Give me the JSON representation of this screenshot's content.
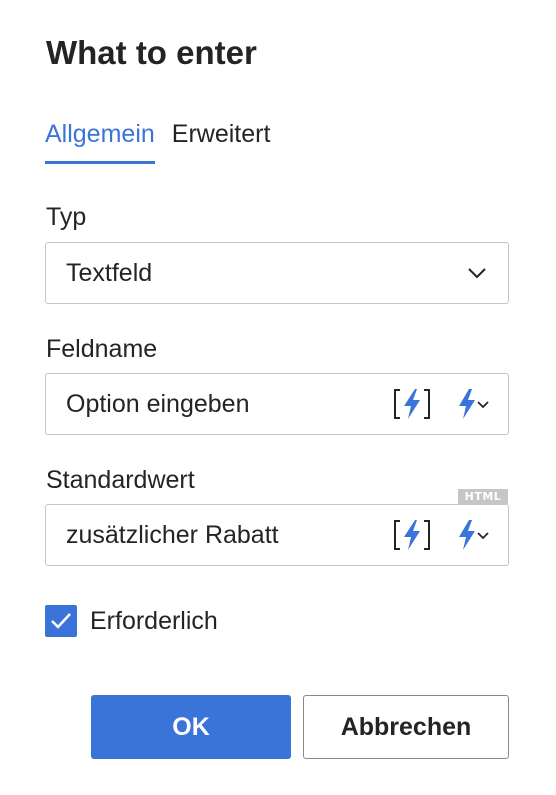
{
  "dialog": {
    "title": "What to enter"
  },
  "tabs": [
    {
      "label": "Allgemein",
      "active": true
    },
    {
      "label": "Erweitert",
      "active": false
    }
  ],
  "type_field": {
    "label": "Typ",
    "value": "Textfeld",
    "icon": "chevron-down-icon"
  },
  "fieldname": {
    "label": "Feldname",
    "value": "Option eingeben",
    "icons": [
      "bracket-bolt-icon",
      "bolt-dropdown-icon"
    ]
  },
  "default_value": {
    "label": "Standardwert",
    "value": "zusätzlicher Rabatt",
    "badge": "HTML",
    "icons": [
      "bracket-bolt-icon",
      "bolt-dropdown-icon"
    ]
  },
  "required": {
    "label": "Erforderlich",
    "checked": true
  },
  "buttons": {
    "ok": "OK",
    "cancel": "Abbrechen"
  },
  "colors": {
    "accent": "#3b74d9",
    "text": "#252423",
    "border": "#c8c6c4"
  }
}
